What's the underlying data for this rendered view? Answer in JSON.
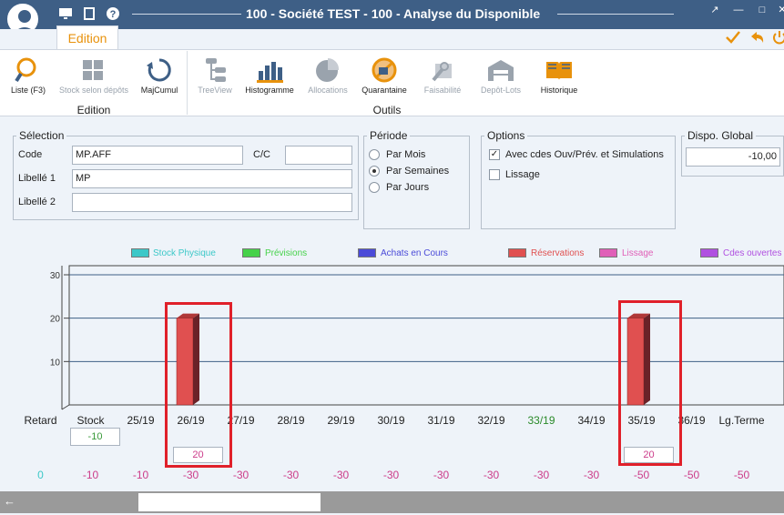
{
  "window": {
    "title": "100 - Société TEST - 100 - Analyse du Disponible"
  },
  "title_icons": [
    "monitor-icon",
    "film-icon",
    "help-icon"
  ],
  "window_buttons": [
    "restore-icon",
    "minimize-icon",
    "maximize-icon",
    "close-icon"
  ],
  "tabs": [
    {
      "label": "Edition"
    }
  ],
  "actions": [
    "check-icon",
    "undo-icon",
    "power-icon"
  ],
  "ribbon": {
    "groups": [
      {
        "label": "Edition",
        "buttons": [
          {
            "label": "Liste (F3)",
            "icon": "search-icon",
            "enabled": true
          },
          {
            "label": "Stock selon dépôts",
            "icon": "boxes-icon",
            "enabled": false
          },
          {
            "label": "MajCumul",
            "icon": "refresh-icon",
            "enabled": true
          }
        ]
      },
      {
        "label": "Outils",
        "buttons": [
          {
            "label": "TreeView",
            "icon": "tree-icon",
            "enabled": false
          },
          {
            "label": "Histogramme",
            "icon": "bar-chart-icon",
            "enabled": true
          },
          {
            "label": "Allocations",
            "icon": "pie-chart-icon",
            "enabled": false
          },
          {
            "label": "Quarantaine",
            "icon": "no-entry-icon",
            "enabled": true
          },
          {
            "label": "Faisabilité",
            "icon": "wrench-icon",
            "enabled": false
          },
          {
            "label": "Depôt-Lots",
            "icon": "warehouse-icon",
            "enabled": false
          },
          {
            "label": "Historique",
            "icon": "book-icon",
            "enabled": true
          }
        ]
      }
    ]
  },
  "selection": {
    "legend": "Sélection",
    "code_label": "Code",
    "code_value": "MP.AFF",
    "cc_label": "C/C",
    "cc_value": "",
    "libelle1_label": "Libellé 1",
    "libelle1_value": "MP",
    "libelle2_label": "Libellé 2",
    "libelle2_value": ""
  },
  "periode": {
    "legend": "Période",
    "options": [
      {
        "label": "Par Mois",
        "selected": false
      },
      {
        "label": "Par Semaines",
        "selected": true
      },
      {
        "label": "Par Jours",
        "selected": false
      }
    ]
  },
  "options": {
    "legend": "Options",
    "items": [
      {
        "label": "Avec cdes Ouv/Prév. et Simulations",
        "checked": true
      },
      {
        "label": "Lissage",
        "checked": false
      }
    ]
  },
  "dispo": {
    "legend": "Dispo. Global",
    "value": "-10,00"
  },
  "chart_data": {
    "type": "bar",
    "legend": [
      {
        "name": "Stock Physique",
        "color": "#3cc8c8"
      },
      {
        "name": "Prévisions",
        "color": "#46d24a"
      },
      {
        "name": "Achats en Cours",
        "color": "#4b4bd8"
      },
      {
        "name": "Réservations",
        "color": "#e05050"
      },
      {
        "name": "Lissage",
        "color": "#e060b8"
      },
      {
        "name": "Cdes ouvertes",
        "color": "#b050e0"
      }
    ],
    "categories": [
      "Retard",
      "Stock",
      "25/19",
      "26/19",
      "27/19",
      "28/19",
      "29/19",
      "30/19",
      "31/19",
      "32/19",
      "33/19",
      "34/19",
      "35/19",
      "36/19",
      "Lg.Terme"
    ],
    "category_colors": {
      "33/19": "#2a8a2a"
    },
    "yticks": [
      10,
      20,
      30
    ],
    "ylim": [
      0,
      30
    ],
    "series": [
      {
        "name": "Réservations",
        "values": [
          0,
          0,
          0,
          20,
          0,
          0,
          0,
          0,
          0,
          0,
          0,
          0,
          20,
          0,
          0
        ]
      }
    ]
  },
  "grid_rows": {
    "stock_value": "-10",
    "reservations": {
      "26/19": "20",
      "35/19": "20"
    },
    "dispo_values": [
      "0",
      "-10",
      "-10",
      "-30",
      "-30",
      "-30",
      "-30",
      "-30",
      "-30",
      "-30",
      "-30",
      "-30",
      "-50",
      "-50",
      "-50"
    ]
  }
}
